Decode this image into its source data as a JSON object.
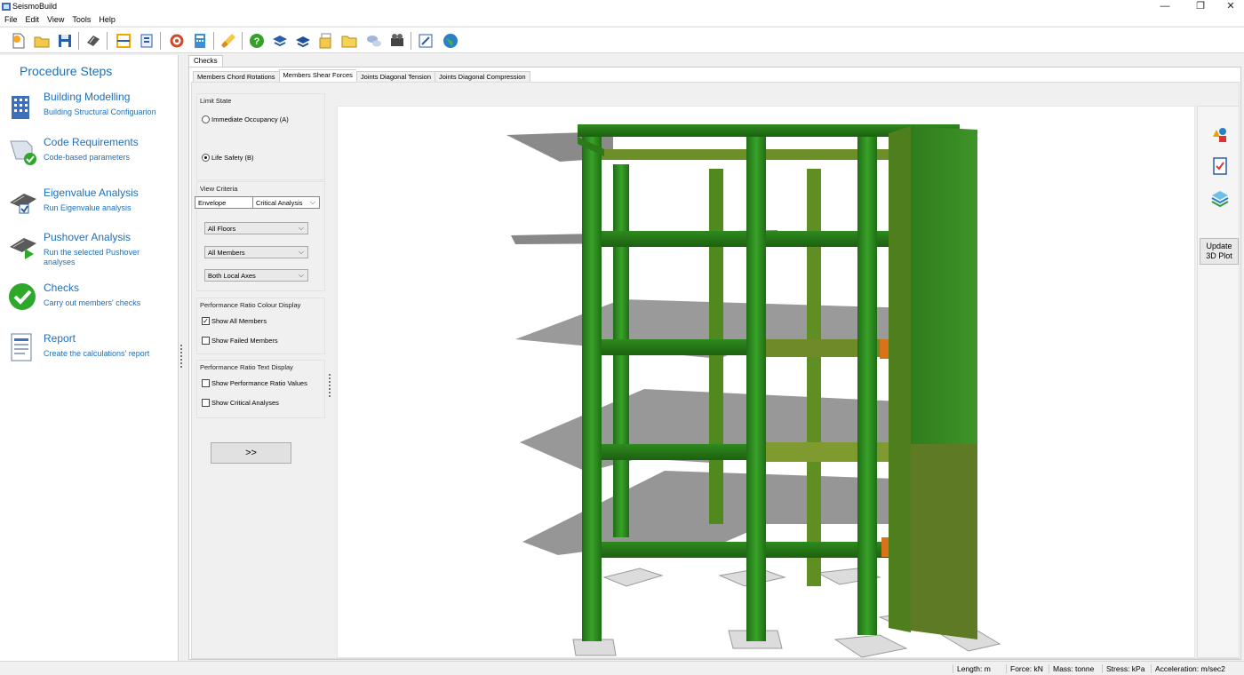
{
  "window": {
    "title": "SeismoBuild",
    "controls": {
      "minimize": "—",
      "maximize": "❐",
      "close": "✕"
    }
  },
  "menu": [
    "File",
    "Edit",
    "View",
    "Tools",
    "Help"
  ],
  "toolbar_icons": [
    "new-file-icon",
    "open-folder-icon",
    "save-icon",
    "run-analysis-icon",
    "frame-icon",
    "export-icon",
    "settings-icon",
    "calculator-icon",
    "brush-icon",
    "help-icon",
    "manual-icon",
    "book-icon",
    "documents-icon",
    "folder-icon",
    "chat-icon",
    "video-icon",
    "edit-icon",
    "web-icon"
  ],
  "left_panel": {
    "title": "Procedure Steps",
    "steps": [
      {
        "head": "Building Modelling",
        "sub": "Building Structural Configuarion",
        "icon": "building-icon"
      },
      {
        "head": "Code Requirements",
        "sub": "Code-based parameters",
        "icon": "document-check-icon"
      },
      {
        "head": "Eigenvalue Analysis",
        "sub": "Run Eigenvalue analysis",
        "icon": "eigenvalue-icon"
      },
      {
        "head": "Pushover Analysis",
        "sub": "Run the selected Pushover analyses",
        "icon": "pushover-icon"
      },
      {
        "head": "Checks",
        "sub": "Carry out members' checks",
        "icon": "checkmark-icon"
      },
      {
        "head": "Report",
        "sub": "Create the calculations' report",
        "icon": "report-icon"
      }
    ]
  },
  "main_tab": "Checks",
  "subtabs": [
    "Members Chord Rotations",
    "Members Shear Forces",
    "Joints Diagonal Tension",
    "Joints Diagonal Compression"
  ],
  "active_subtab": "Members Shear Forces",
  "controls": {
    "limit_state": {
      "title": "Limit State",
      "options": [
        "Immediate Occupancy (A)",
        "Life Safety (B)"
      ],
      "selected": "Life Safety (B)"
    },
    "view_criteria": {
      "title": "View Criteria",
      "mode": "Envelope",
      "analysis": "Critical Analysis",
      "floors": "All Floors",
      "members": "All Members",
      "axes": "Both Local Axes"
    },
    "colour_display": {
      "title": "Performance Ratio Colour Display",
      "show_all": "Show All Members",
      "show_all_checked": true,
      "show_failed": "Show Failed Members",
      "show_failed_checked": false
    },
    "text_display": {
      "title": "Performance Ratio Text Display",
      "show_values": "Show Performance Ratio Values",
      "show_values_checked": false,
      "show_critical": "Show Critical Analyses",
      "show_critical_checked": false
    },
    "next_button": ">>"
  },
  "right_tools": {
    "icons": [
      "shapes-icon",
      "checklist-icon",
      "layers-icon"
    ],
    "update_label": "Update\n3D Plot"
  },
  "status": {
    "length": "Length: m",
    "force": "Force: kN",
    "mass": "Mass: tonne",
    "stress": "Stress: kPa",
    "acceleration": "Acceleration: m/sec2"
  },
  "colors": {
    "member_ok": "#2f8a1e",
    "member_mid": "#7a9a2a",
    "member_high": "#d9731a",
    "slab": "#8f8f8f",
    "accent_text": "#1f6fb8"
  }
}
